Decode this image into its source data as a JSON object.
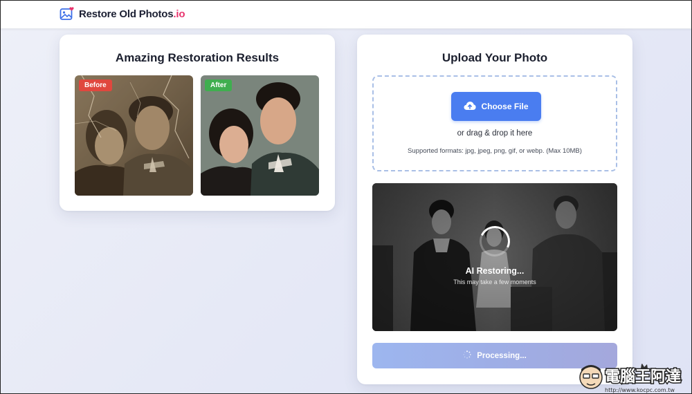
{
  "header": {
    "brand_name": "Restore Old Photos",
    "brand_tld": ".io",
    "logo_icon": "photo-heart-icon"
  },
  "results": {
    "title": "Amazing Restoration Results",
    "before_label": "Before",
    "after_label": "After"
  },
  "upload": {
    "title": "Upload Your Photo",
    "choose_button": "Choose File",
    "choose_icon": "cloud-upload-icon",
    "drag_text": "or drag & drop it here",
    "formats_text": "Supported formats: jpg, jpeg, png, gif, or webp. (Max 10MB)",
    "status_title": "AI Restoring...",
    "status_subtitle": "This may take a few moments",
    "processing_label": "Processing..."
  },
  "watermark": {
    "text": "電腦王阿達",
    "url": "http://www.kocpc.com.tw"
  },
  "colors": {
    "accent": "#4a7df0",
    "tld_pink": "#e8336d",
    "before_badge": "#e0473e",
    "after_badge": "#3fae4f"
  }
}
